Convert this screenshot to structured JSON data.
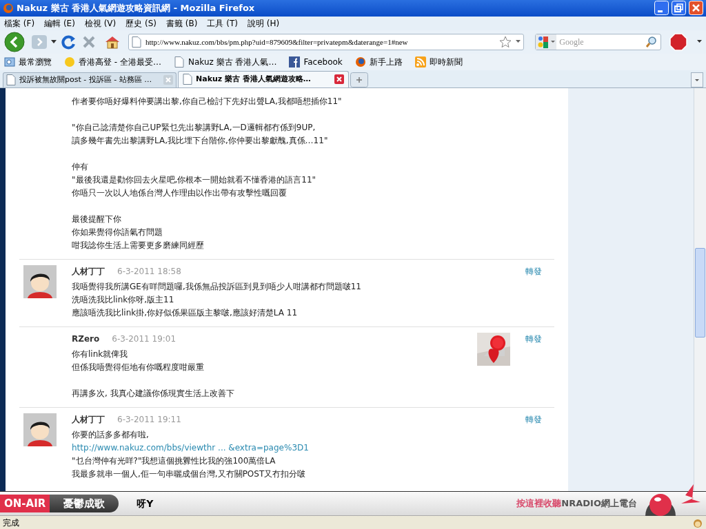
{
  "window": {
    "title": "Nakuz 樂古 香港人氣網遊攻略資訊網 - Mozilla Firefox"
  },
  "menu": [
    "檔案 (F)",
    "編輯 (E)",
    "檢視 (V)",
    "歷史 (S)",
    "書籤 (B)",
    "工具 (T)",
    "說明 (H)"
  ],
  "address_bar": {
    "value": "http://www.nakuz.com/bbs/pm.php?uid=879609&filter=privatepm&daterange=1#new"
  },
  "search": {
    "placeholder": "Google"
  },
  "bookmarks": [
    {
      "label": "最常瀏覽",
      "kind": "search"
    },
    {
      "label": "香港高登 - 全港最受…",
      "kind": "dot"
    },
    {
      "label": "Nakuz 樂古 香港人氣…",
      "kind": "page"
    },
    {
      "label": "Facebook",
      "kind": "facebook"
    },
    {
      "label": "新手上路",
      "kind": "firefox"
    },
    {
      "label": "即時新聞",
      "kind": "rss"
    }
  ],
  "tabs": [
    {
      "label": "投訴被無故關post - 投訴區 - 站務區 …",
      "selected": false
    },
    {
      "label": "Nakuz 樂古 香港人氣網遊攻略…",
      "selected": true
    }
  ],
  "posts": [
    {
      "paragraphs": [
        [
          {
            "kind": "text",
            "text": "作者要你唔好爆料仲要講出黎,你自己檢討下先好出聲LA,我都唔想插你11\""
          }
        ],
        [
          {
            "kind": "text",
            "text": "\"你自己諗清楚你自己UP緊乜先出黎講野LA,一D邏輯都冇係到9UP,"
          },
          {
            "kind": "text",
            "text": "讀多幾年書先出黎講野LA,我比埋下台階你,你仲要出黎獻醜,真係…11\""
          }
        ],
        [
          {
            "kind": "text",
            "text": "仲有"
          },
          {
            "kind": "text",
            "text": "\"最後我還是勸你回去火星吧,你根本一開始就看不懂香港的語言11\""
          },
          {
            "kind": "text",
            "text": "你唔只一次以人地係台灣人作理由以作出帶有攻擊性嘅回覆"
          }
        ],
        [
          {
            "kind": "text",
            "text": "最後提醒下你"
          },
          {
            "kind": "text",
            "text": "你如果覺得你語氣冇問題"
          },
          {
            "kind": "text",
            "text": "咁我諗你生活上需要更多磨練同經歷"
          }
        ]
      ]
    },
    {
      "author": "人材丁丁",
      "time": "6-3-2011 18:58",
      "kind": "cartoon",
      "action": "轉發",
      "paragraphs": [
        [
          {
            "kind": "text",
            "text": "我唔覺得我所講GE有咩問題囉,我係無品投訴區到見到唔少人咁講都冇問題啵11"
          },
          {
            "kind": "text",
            "text": "洗唔洗我比link你呀,版主11"
          },
          {
            "kind": "text",
            "text": "應該唔洗我比link掛,你好似係果區版主黎啵,應該好清楚LA 11"
          }
        ]
      ]
    },
    {
      "author": "RZero",
      "time": "6-3-2011 19:01",
      "action": "轉發",
      "paragraphs": [
        [
          {
            "kind": "text",
            "text": "你有link就俾我"
          },
          {
            "kind": "text",
            "text": "但係我唔覺得佢地有你嘅程度咁嚴重"
          }
        ],
        [
          {
            "kind": "text",
            "text": "再講多次, 我真心建議你係現實生活上改善下"
          }
        ]
      ]
    },
    {
      "author": "人材丁丁",
      "time": "6-3-2011 19:11",
      "kind": "cartoon",
      "action": "轉發",
      "paragraphs": [
        [
          {
            "kind": "text",
            "text": "你要的話多多都有啦,"
          },
          {
            "kind": "link",
            "text": "http://www.nakuz.com/bbs/viewthr ... &extra=page%3D1"
          },
          {
            "kind": "text",
            "text": "\"乜台灣仲有光咩?\"我想這個挑釁性比我的強100萬倍LA"
          },
          {
            "kind": "text",
            "text": "我最多就串一個人,佢一句串曬成個台灣,又冇關POST又冇扣分啵"
          }
        ]
      ]
    }
  ],
  "radio_bar": {
    "badge": "ON-AIR",
    "song": "憂鬱成歌",
    "artist": "呀Y",
    "prompt": "按這裡收聽",
    "station": "NRADIO網上電台"
  },
  "status_bar": {
    "text": "完成"
  }
}
